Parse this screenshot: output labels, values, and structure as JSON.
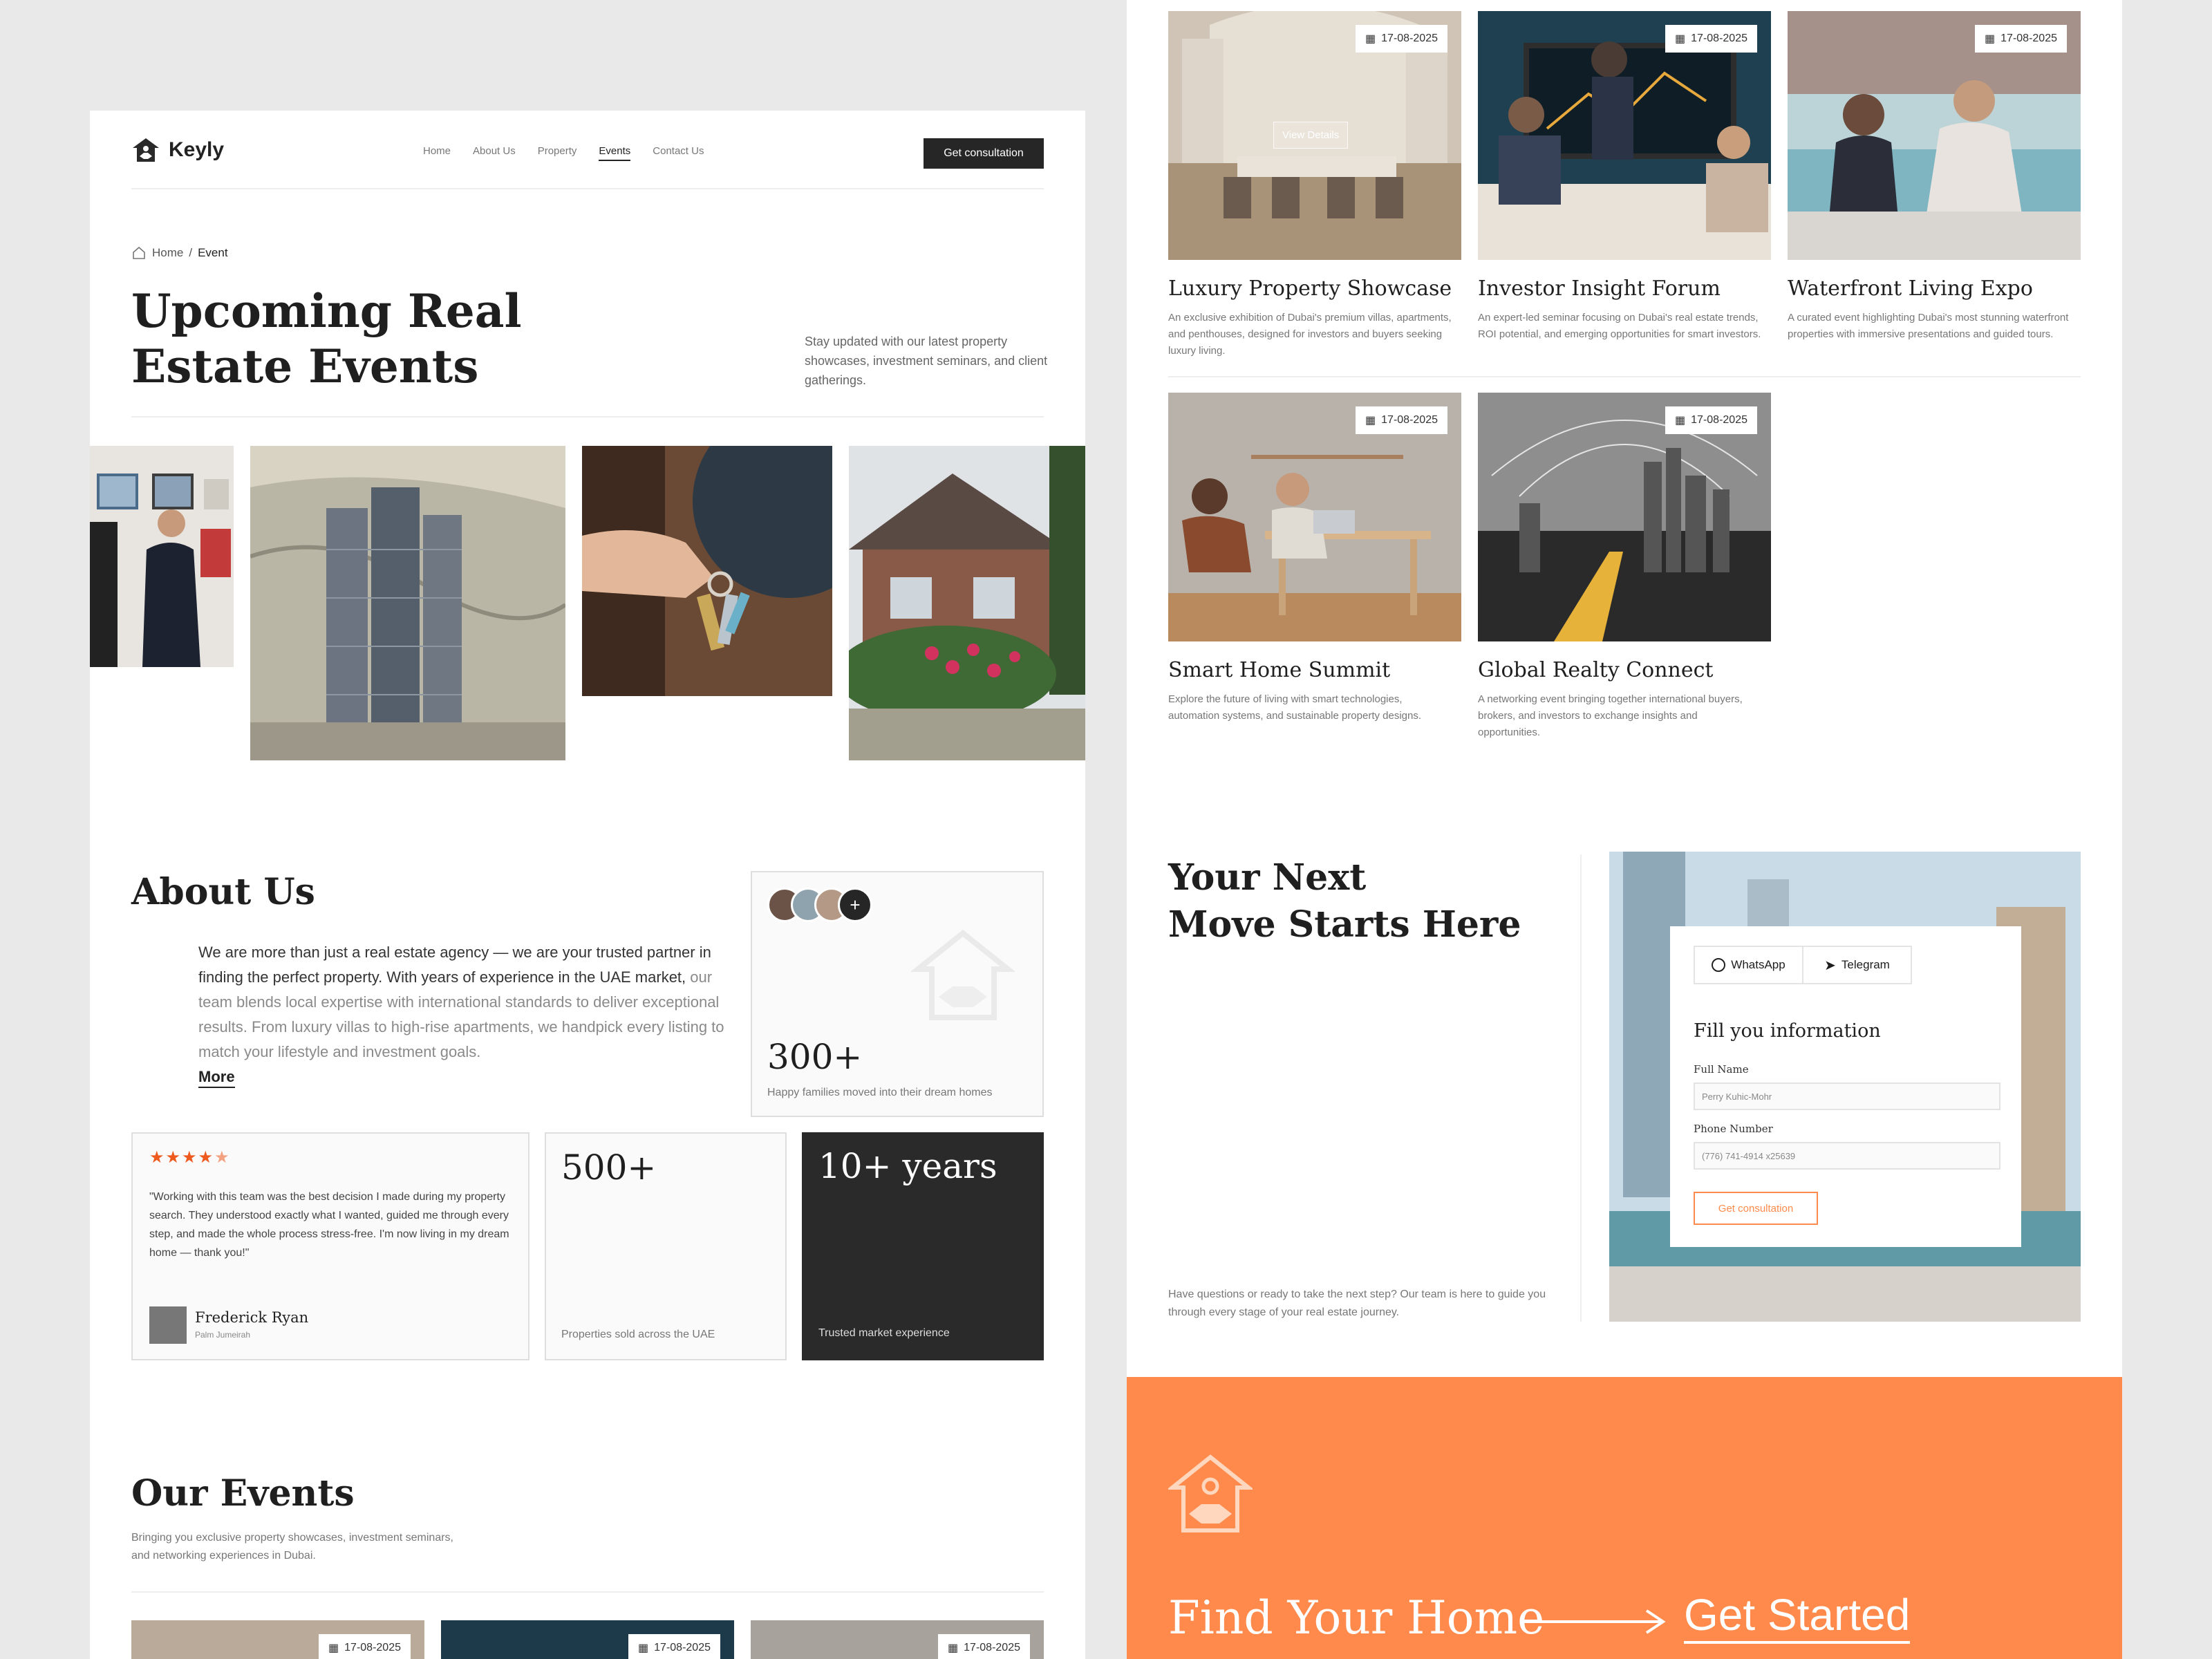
{
  "brand": {
    "name": "Keyly"
  },
  "nav": {
    "items": [
      "Home",
      "About Us",
      "Property",
      "Events",
      "Contact Us"
    ],
    "active": "Events",
    "cta": "Get consultation"
  },
  "breadcrumb": {
    "home": "Home",
    "sep": "/",
    "current": "Event"
  },
  "hero": {
    "title_line1": "Upcoming Real",
    "title_line2": "Estate Events",
    "subtitle": "Stay updated with our latest property showcases, investment seminars, and client gatherings."
  },
  "about": {
    "title": "About Us",
    "text_strong": "We are more than just a real estate agency — we are your trusted partner in finding the perfect property. With years of experience in the UAE market,",
    "text_muted": " our team blends local expertise with international standards to deliver exceptional results. From luxury villas to high-rise apartments, we handpick every listing to match your lifestyle and investment goals.",
    "more": "More",
    "families_count": "300+",
    "families_label": "Happy families moved into their dream homes",
    "avatar_more": "+",
    "rating": 4.5,
    "review": "\"Working with this team was the best decision I made during my property search. They understood exactly what I wanted, guided me through every step, and made the whole process stress-free. I'm now living in my dream home — thank you!\"",
    "reviewer_name": "Frederick Ryan",
    "reviewer_location": "Palm Jumeirah",
    "sold_count": "500+",
    "sold_label": "Properties sold across the UAE",
    "years": "10+ years",
    "years_label": "Trusted market experience"
  },
  "our_events": {
    "title": "Our Events",
    "subtitle": "Bringing you exclusive property showcases, investment seminars, and networking experiences in Dubai.",
    "date": "17-08-2025"
  },
  "events": [
    {
      "title": "Luxury Property Showcase",
      "date": "17-08-2025",
      "desc": "An exclusive exhibition of Dubai's premium villas, apartments, and penthouses, designed for investors and buyers seeking luxury living.",
      "action": "View Details"
    },
    {
      "title": "Investor Insight Forum",
      "date": "17-08-2025",
      "desc": "An expert-led seminar focusing on Dubai's real estate trends, ROI potential, and emerging opportunities for smart investors."
    },
    {
      "title": "Waterfront Living Expo",
      "date": "17-08-2025",
      "desc": "A curated event highlighting Dubai's most stunning waterfront properties with immersive presentations and guided tours."
    },
    {
      "title": "Smart Home Summit",
      "date": "17-08-2025",
      "desc": "Explore the future of living with smart technologies, automation systems, and sustainable property designs."
    },
    {
      "title": "Global Realty Connect",
      "date": "17-08-2025",
      "desc": "A networking event bringing together international buyers, brokers, and investors to exchange insights and opportunities."
    }
  ],
  "contact": {
    "title_line1": "Your Next",
    "title_line2": "Move Starts Here",
    "text": "Have questions or ready to take the next step? Our team is here to guide you through every stage of your real estate journey.",
    "whatsapp": "WhatsApp",
    "telegram": "Telegram",
    "form_title": "Fill you information",
    "name_label": "Full Name",
    "name_placeholder": "Perry Kuhic-Mohr",
    "phone_label": "Phone Number",
    "phone_placeholder": "(776) 741-4914 x25639",
    "submit": "Get consultation"
  },
  "footer_cta": {
    "text": "Find Your Home",
    "link": "Get Started"
  },
  "colors": {
    "accent": "#ff8a4c",
    "dark": "#262626",
    "star": "#ee5a1e"
  }
}
